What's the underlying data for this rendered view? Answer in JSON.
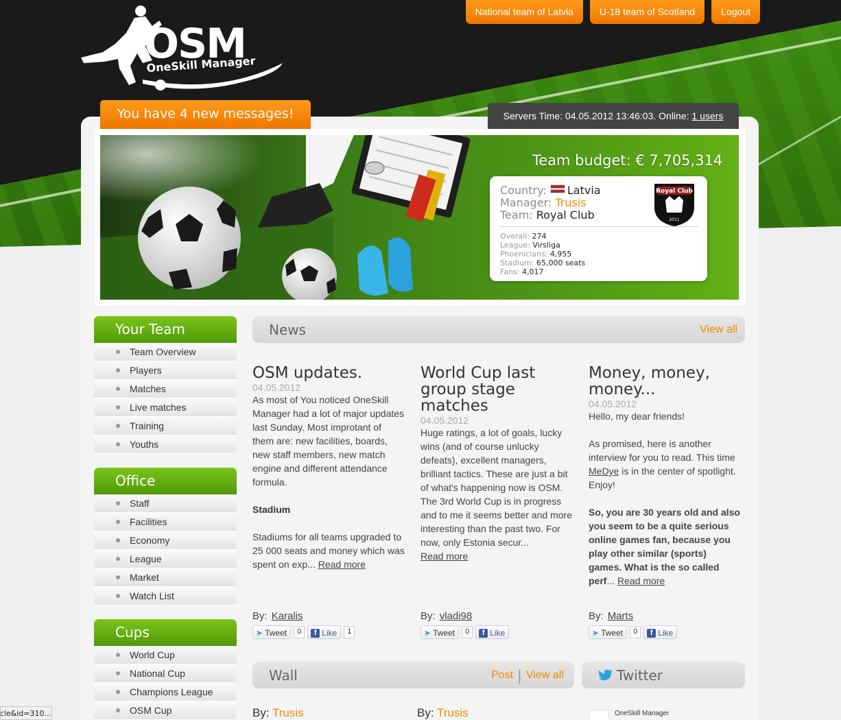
{
  "topnav": [
    "National team of Latvia",
    "U-18 team of Scotland",
    "Logout"
  ],
  "logo": {
    "big": "OSM",
    "small": "OneSkill Manager"
  },
  "messages_tab": "You have 4 new messages!",
  "server": {
    "text": "Servers Time: 04.05.2012 13:46:03. Online: ",
    "online_link": "1 users"
  },
  "banner": {
    "budget": "Team budget: € 7,705,314",
    "country_label": "Country:",
    "country": "Latvia",
    "manager_label": "Manager:",
    "manager": "Trusis",
    "team_label": "Team:",
    "team": "Royal Club",
    "crest_text": "Royal Club",
    "crest_year": "2011",
    "stats": [
      {
        "label": "Overall:",
        "value": "274"
      },
      {
        "label": "League:",
        "value": "Virsliga"
      },
      {
        "label": "Phoenicians:",
        "value": "4,955"
      },
      {
        "label": "Stadium:",
        "value": "65,000 seats"
      },
      {
        "label": "Fans:",
        "value": "4,017"
      }
    ]
  },
  "sidebar": {
    "your_team": {
      "title": "Your Team",
      "items": [
        "Team Overview",
        "Players",
        "Matches",
        "Live matches",
        "Training",
        "Youths"
      ]
    },
    "office": {
      "title": "Office",
      "items": [
        "Staff",
        "Facilities",
        "Economy",
        "League",
        "Market",
        "Watch List"
      ]
    },
    "cups": {
      "title": "Cups",
      "items": [
        "World Cup",
        "National Cup",
        "Champions League",
        "OSM Cup"
      ]
    }
  },
  "news": {
    "title": "News",
    "view_all": "View all",
    "articles": [
      {
        "title": "OSM updates.",
        "date": "04.05.2012",
        "body1": "As most of You noticed OneSkill Manager had a lot of major updates last Sunday. Most improtant of them are: new facilities, boards, new staff members, new match engine and different attendance formula.",
        "subhead": "Stadium",
        "body2": "Stadiums for all teams upgraded to 25 000 seats and money which was spent on exp... ",
        "read_more": "Read more",
        "by": "By:",
        "author": "Karalis",
        "tweet": "Tweet",
        "tweets": "0",
        "like": "Like",
        "likes": "1"
      },
      {
        "title": "World Cup last group stage matches",
        "date": "04.05.2012",
        "body1": "Huge ratings, a lot of goals, lucky wins (and of course unlucky defeats), excellent managers, brilliant tactics. These are just a bit of what's happening now is OSM. The 3rd World Cup is in progress and to me it seems better and more interesting than the past two. For now, only Estonia secur...",
        "read_more": "Read more",
        "by": "By:",
        "author": "vladi98",
        "tweet": "Tweet",
        "tweets": "0",
        "like": "Like"
      },
      {
        "title": "Money, money, money...",
        "date": "04.05.2012",
        "body1a": "Hello, my dear friends!",
        "body1b": "As promised, here is another interview for you to read. This time ",
        "link": "MeDye",
        "body1c": " is in the center of spotlight. Enjoy!",
        "strong": "So, you are 30 years old and also you seem to be a quite serious online games fan, because you play other similar (sports) games. What is the so called perf",
        "ellipsis": "... ",
        "read_more": "Read more",
        "by": "By:",
        "author": "Marts",
        "tweet": "Tweet",
        "tweets": "0",
        "like": "Like"
      }
    ]
  },
  "wall": {
    "title": "Wall",
    "post": "Post",
    "view_all": "View all",
    "by": "By:",
    "entries": [
      "Trusis",
      "Trusis"
    ]
  },
  "twitter": {
    "title": "Twitter",
    "item": "OneSkill Manager"
  },
  "status_url": "...article&id=310",
  "colors": {
    "accent": "#f08a00",
    "green": "#5aa80e",
    "dark": "#1a1a1a"
  }
}
